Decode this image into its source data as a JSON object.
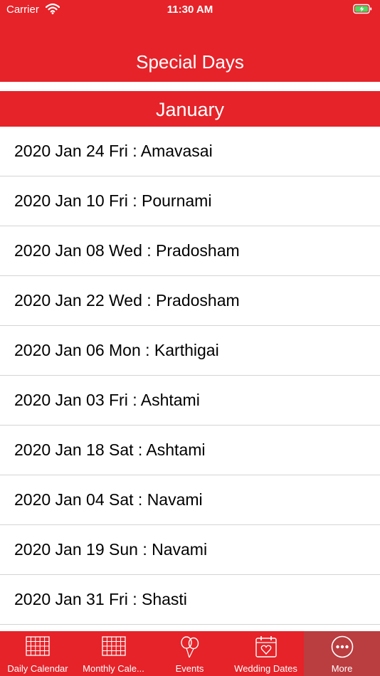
{
  "status": {
    "carrier": "Carrier",
    "time": "11:30 AM"
  },
  "header": {
    "title": "Special Days"
  },
  "section": {
    "title": "January"
  },
  "items": [
    "2020 Jan 24 Fri : Amavasai",
    "2020 Jan 10 Fri : Pournami",
    "2020 Jan 08 Wed : Pradosham",
    "2020 Jan 22 Wed : Pradosham",
    "2020 Jan 06 Mon : Karthigai",
    "2020 Jan 03 Fri : Ashtami",
    "2020 Jan 18 Sat : Ashtami",
    "2020 Jan 04 Sat : Navami",
    "2020 Jan 19 Sun : Navami",
    "2020 Jan 31 Fri : Shasti"
  ],
  "tabs": [
    {
      "label": "Daily Calendar",
      "icon": "calendar-grid-icon"
    },
    {
      "label": "Monthly Cale...",
      "icon": "calendar-grid-icon"
    },
    {
      "label": "Events",
      "icon": "balloons-icon"
    },
    {
      "label": "Wedding Dates",
      "icon": "heart-calendar-icon"
    },
    {
      "label": "More",
      "icon": "more-icon"
    }
  ],
  "selected_tab": "More",
  "colors": {
    "primary": "#e52329",
    "selected_tab": "#ba3d40",
    "battery": "#4cd964"
  }
}
